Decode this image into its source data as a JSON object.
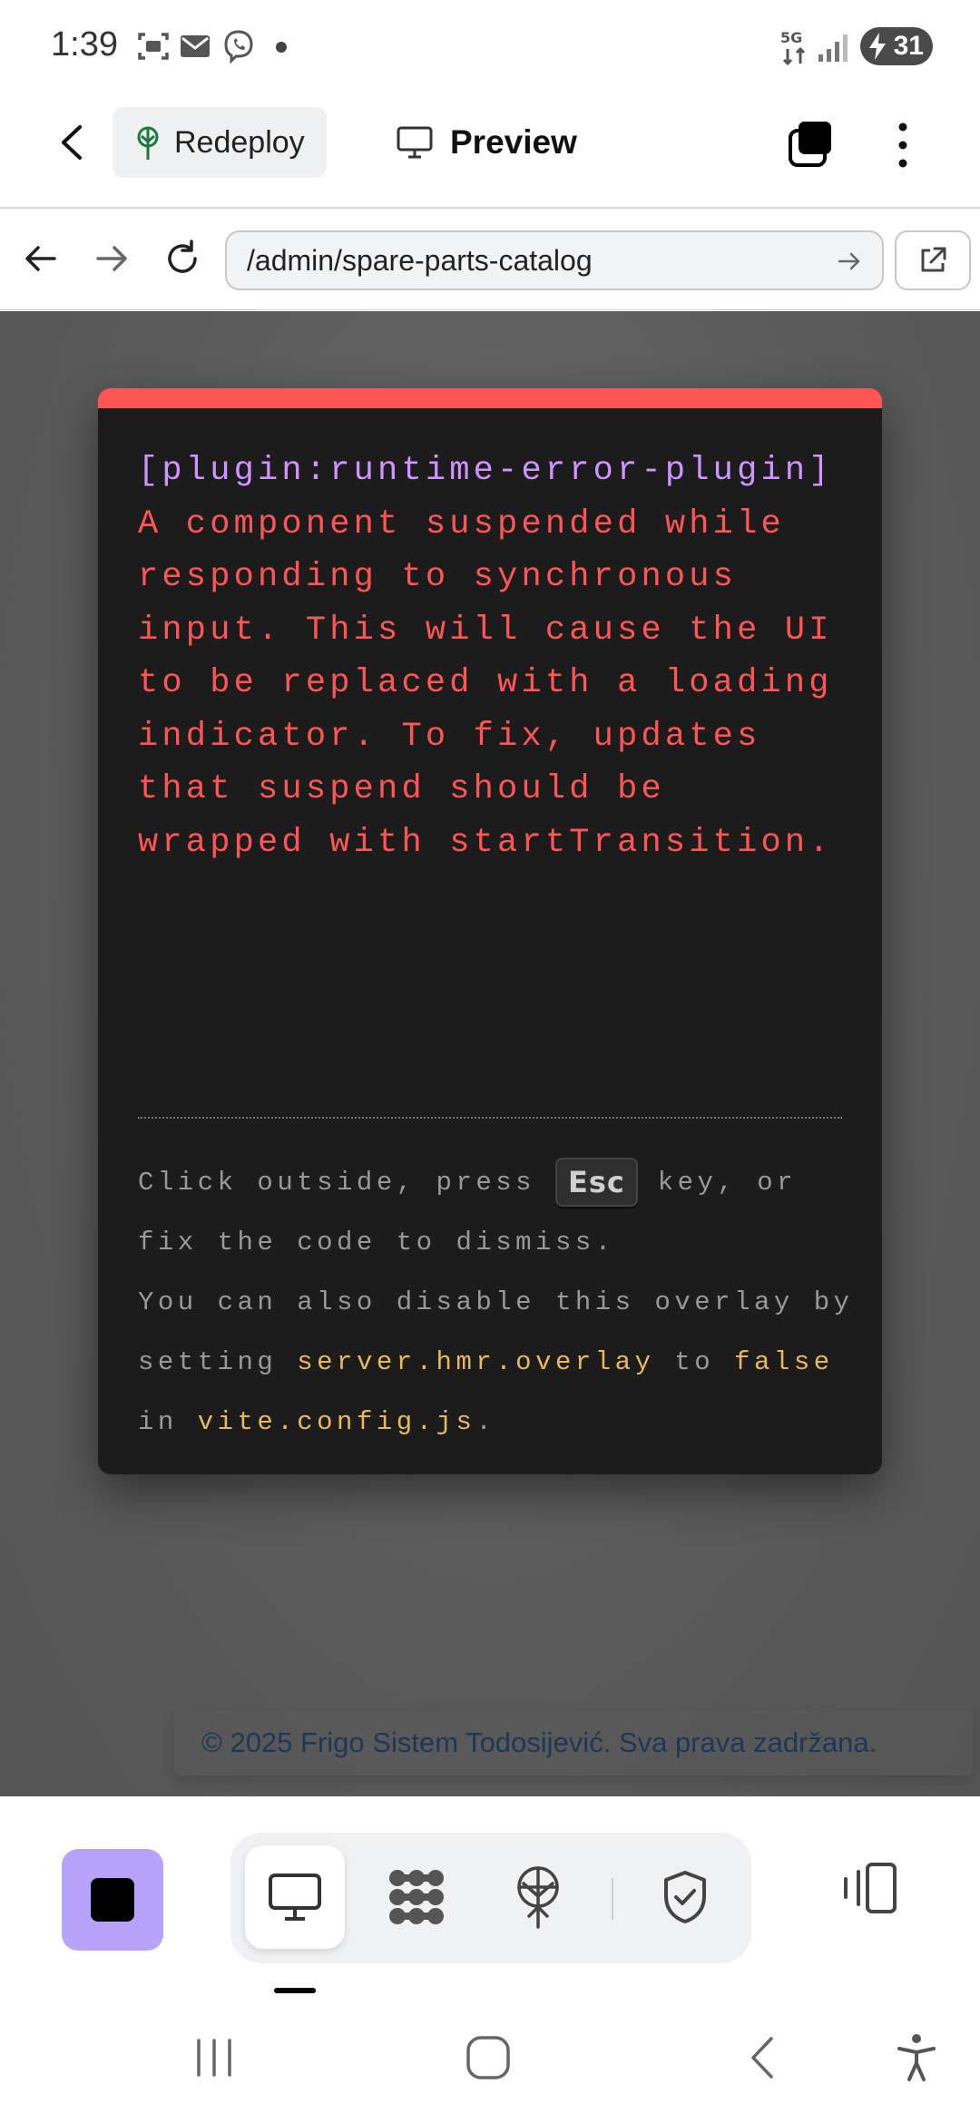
{
  "status_bar": {
    "time": "1:39",
    "network": "5G",
    "battery": "31",
    "icons": [
      "screenshot-icon",
      "mail-icon",
      "viber-icon",
      "notification-dot"
    ]
  },
  "app_bar": {
    "redeploy_label": "Redeploy",
    "preview_label": "Preview"
  },
  "browser": {
    "url": "/admin/spare-parts-catalog"
  },
  "error_overlay": {
    "plugin_tag": "[plugin:runtime-error-plugin]",
    "message": " A component suspended while responding to synchronous input. This will cause the UI to be replaced with a loading indicator. To fix, updates that suspend should be wrapped with startTransition.",
    "tip_part1": "Click outside, press ",
    "tip_key": "Esc",
    "tip_part2": " key, or fix the code to dismiss.",
    "tip_part3": "You can also disable this overlay by setting ",
    "tip_code1": "server.hmr.overlay",
    "tip_part4": " to ",
    "tip_code2": "false",
    "tip_part5": " in ",
    "tip_code3": "vite.config.js",
    "tip_part6": "."
  },
  "footer": {
    "copyright": "© 2025 Frigo Sistem Todosijević. Sva prava zadržana."
  },
  "colors": {
    "error_red": "#ff5555",
    "plugin_purple": "#cf94ff",
    "code_yellow": "#e7b95b",
    "stop_button": "#b8a3fb"
  }
}
